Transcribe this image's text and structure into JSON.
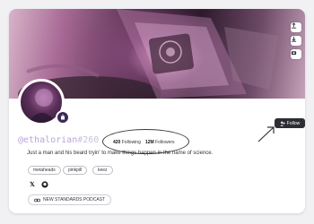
{
  "profile": {
    "handle_name": "@ethalorian",
    "handle_number": "#260",
    "bio": "Just a man and his beard tryin' to make things happen in the name of science.",
    "follow_label": "Follow"
  },
  "stats": {
    "following_count": "420",
    "following_label": "Following",
    "followers_count": "12M",
    "followers_label": "Followers"
  },
  "tags": [
    "metaheads",
    "pinkpill",
    "keez"
  ],
  "socials": [
    "x-icon",
    "github-icon"
  ],
  "podcast": {
    "label": "NEW STANDARDS PODCAST",
    "icon": "link-icon"
  },
  "banner_actions": [
    "upload-icon",
    "download-icon",
    "camera-icon"
  ],
  "colors": {
    "accent": "#2d2d35",
    "handle": "#b7a5d8"
  }
}
